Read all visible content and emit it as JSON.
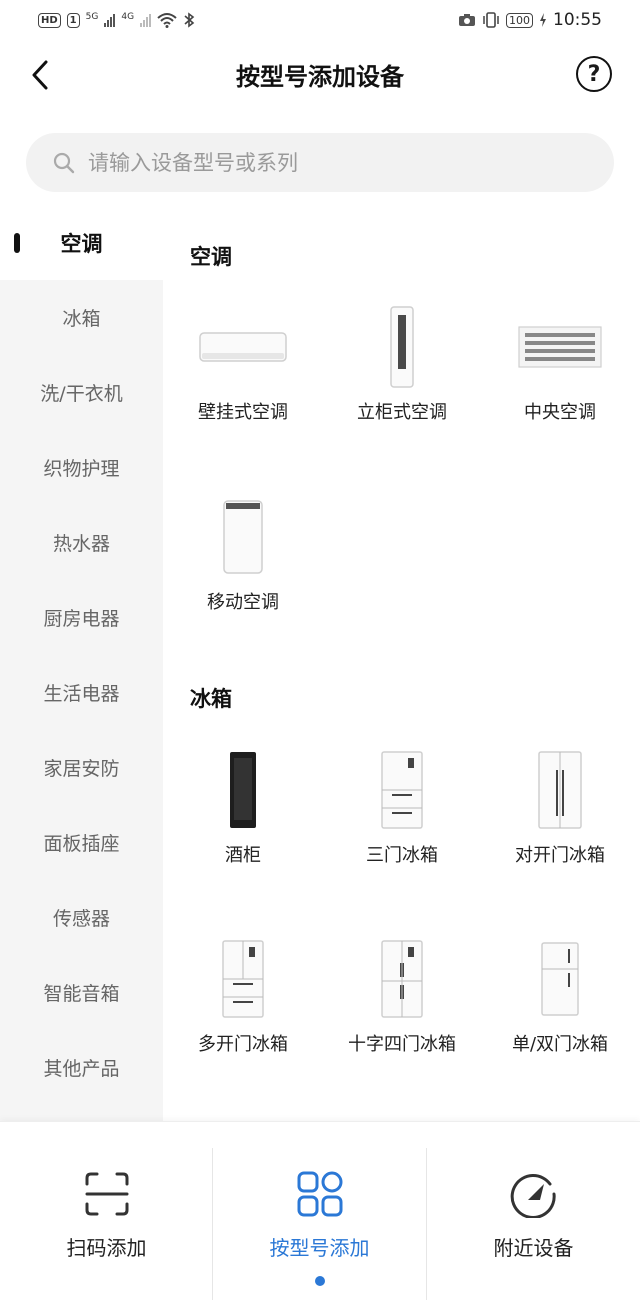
{
  "status_bar": {
    "left_hd": "HD",
    "left_sim": "1",
    "net1": "5G",
    "net2": "4G",
    "battery": "100",
    "time": "10:55"
  },
  "header": {
    "title": "按型号添加设备",
    "help": "?"
  },
  "search": {
    "placeholder": "请输入设备型号或系列"
  },
  "sidebar": {
    "items": [
      {
        "label": "空调",
        "active": true
      },
      {
        "label": "冰箱"
      },
      {
        "label": "洗/干衣机"
      },
      {
        "label": "织物护理"
      },
      {
        "label": "热水器"
      },
      {
        "label": "厨房电器"
      },
      {
        "label": "生活电器"
      },
      {
        "label": "家居安防"
      },
      {
        "label": "面板插座"
      },
      {
        "label": "传感器"
      },
      {
        "label": "智能音箱"
      },
      {
        "label": "其他产品"
      }
    ]
  },
  "sections": [
    {
      "title": "空调",
      "devices": [
        {
          "label": "壁挂式空调",
          "icon": "wall-ac-icon"
        },
        {
          "label": "立柜式空调",
          "icon": "tower-ac-icon"
        },
        {
          "label": "中央空调",
          "icon": "central-ac-icon"
        },
        {
          "label": "移动空调",
          "icon": "portable-ac-icon"
        }
      ]
    },
    {
      "title": "冰箱",
      "devices": [
        {
          "label": "酒柜",
          "icon": "wine-cabinet-icon"
        },
        {
          "label": "三门冰箱",
          "icon": "three-door-fridge-icon"
        },
        {
          "label": "对开门冰箱",
          "icon": "side-by-side-fridge-icon"
        },
        {
          "label": "多开门冰箱",
          "icon": "multi-door-fridge-icon"
        },
        {
          "label": "十字四门冰箱",
          "icon": "cross-four-door-fridge-icon"
        },
        {
          "label": "单/双门冰箱",
          "icon": "single-double-door-fridge-icon"
        }
      ]
    }
  ],
  "bottom_nav": {
    "items": [
      {
        "label": "扫码添加",
        "icon": "scan-icon"
      },
      {
        "label": "按型号添加",
        "icon": "grid-icon",
        "active": true
      },
      {
        "label": "附近设备",
        "icon": "nearby-gauge-icon"
      }
    ]
  },
  "colors": {
    "accent": "#2b78d6",
    "sidebar_bg": "#f5f5f5",
    "search_bg": "#f2f2f2"
  }
}
